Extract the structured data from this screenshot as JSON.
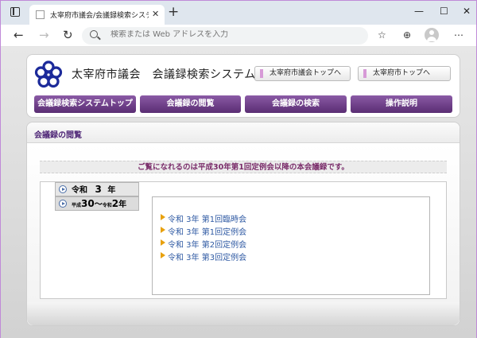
{
  "browser": {
    "tab_title": "太宰府市議会/会議録検索システム",
    "new_tab": "+",
    "minimize": "—",
    "maximize": "☐",
    "close": "✕",
    "address_placeholder": "検索または Web アドレスを入力"
  },
  "header": {
    "site_title": "太宰府市議会　会議録検索システム",
    "top_links": [
      "太宰府市議会トップへ",
      "太宰府市トップへ"
    ],
    "menu": [
      "会議録検索システムトップ",
      "会議録の閲覧",
      "会議録の検索",
      "操作説明"
    ],
    "logo_color": "#1c2a9a"
  },
  "panel": {
    "title": "会議録の閲覧",
    "notice": "ご覧になれるのは平成30年第1回定例会以降の本会議録です。",
    "year_tabs": [
      {
        "era": "令和",
        "year": "3",
        "suffix": "年"
      },
      {
        "era_start": "平成",
        "start": "30",
        "sep": "〜",
        "era_end": "令和",
        "end": "2",
        "suffix": "年"
      }
    ],
    "meetings": [
      "令和 3年 第1回臨時会",
      "令和 3年 第1回定例会",
      "令和 3年 第2回定例会",
      "令和 3年 第3回定例会"
    ]
  },
  "colors": {
    "accent": "#5a2d73",
    "link": "#2f5aa3",
    "notice": "#7a2c6a"
  }
}
